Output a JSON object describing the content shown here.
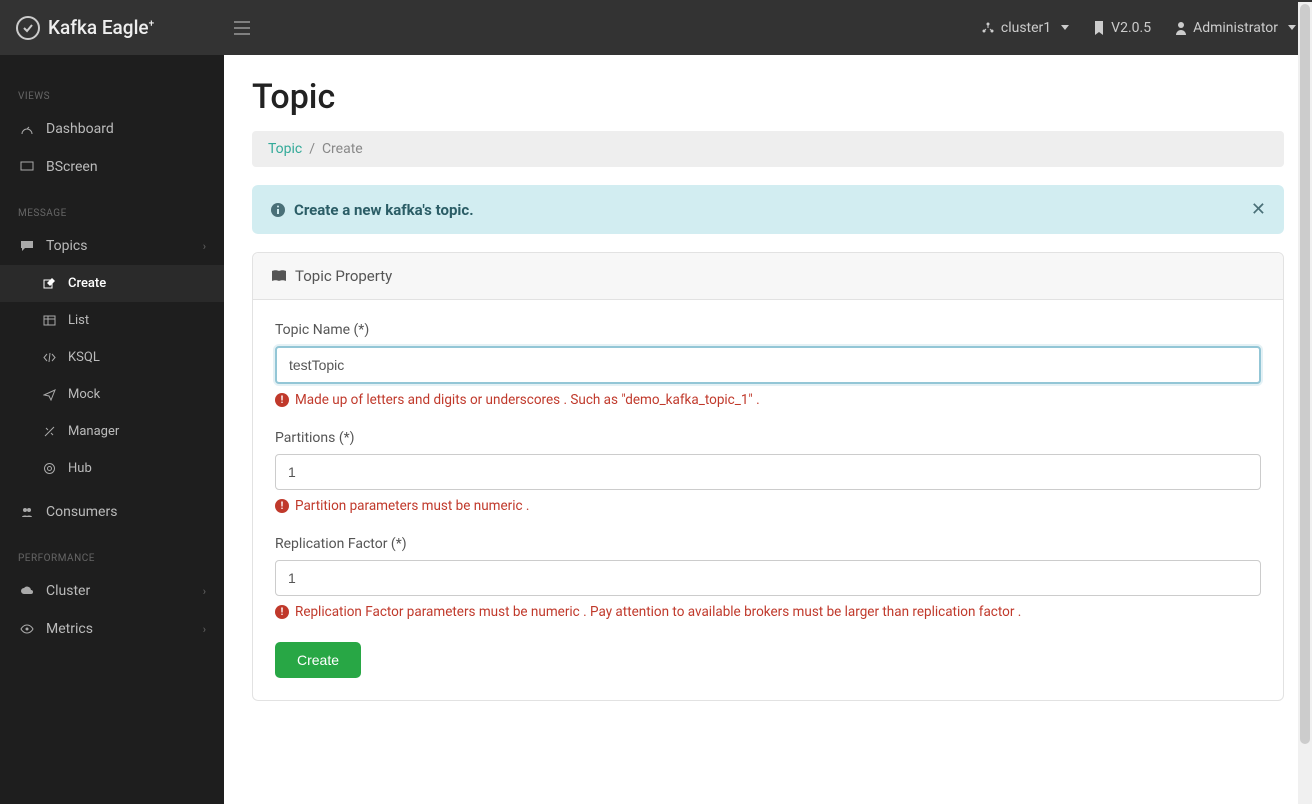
{
  "brand": "Kafka Eagle",
  "brand_sup": "+",
  "topbar": {
    "cluster_label": "cluster1",
    "version": "V2.0.5",
    "user_label": "Administrator"
  },
  "sidebar": {
    "section_views": "VIEWS",
    "dashboard": "Dashboard",
    "bscreen": "BScreen",
    "section_message": "MESSAGE",
    "topics": "Topics",
    "create": "Create",
    "list": "List",
    "ksql": "KSQL",
    "mock": "Mock",
    "manager": "Manager",
    "hub": "Hub",
    "consumers": "Consumers",
    "section_perf": "PERFORMANCE",
    "cluster": "Cluster",
    "metrics": "Metrics"
  },
  "page": {
    "title": "Topic",
    "crumb_root": "Topic",
    "crumb_leaf": "Create"
  },
  "alert": {
    "text": "Create a new kafka's topic."
  },
  "card": {
    "header": "Topic Property"
  },
  "form": {
    "topic_name_label": "Topic Name (*)",
    "topic_name_value": "testTopic",
    "topic_name_helper": "Made up of letters and digits or underscores . Such as \"demo_kafka_topic_1\" .",
    "partitions_label": "Partitions (*)",
    "partitions_value": "1",
    "partitions_helper": "Partition parameters must be numeric .",
    "replication_label": "Replication Factor (*)",
    "replication_value": "1",
    "replication_helper": "Replication Factor parameters must be numeric . Pay attention to available brokers must be larger than replication factor .",
    "submit_label": "Create"
  }
}
